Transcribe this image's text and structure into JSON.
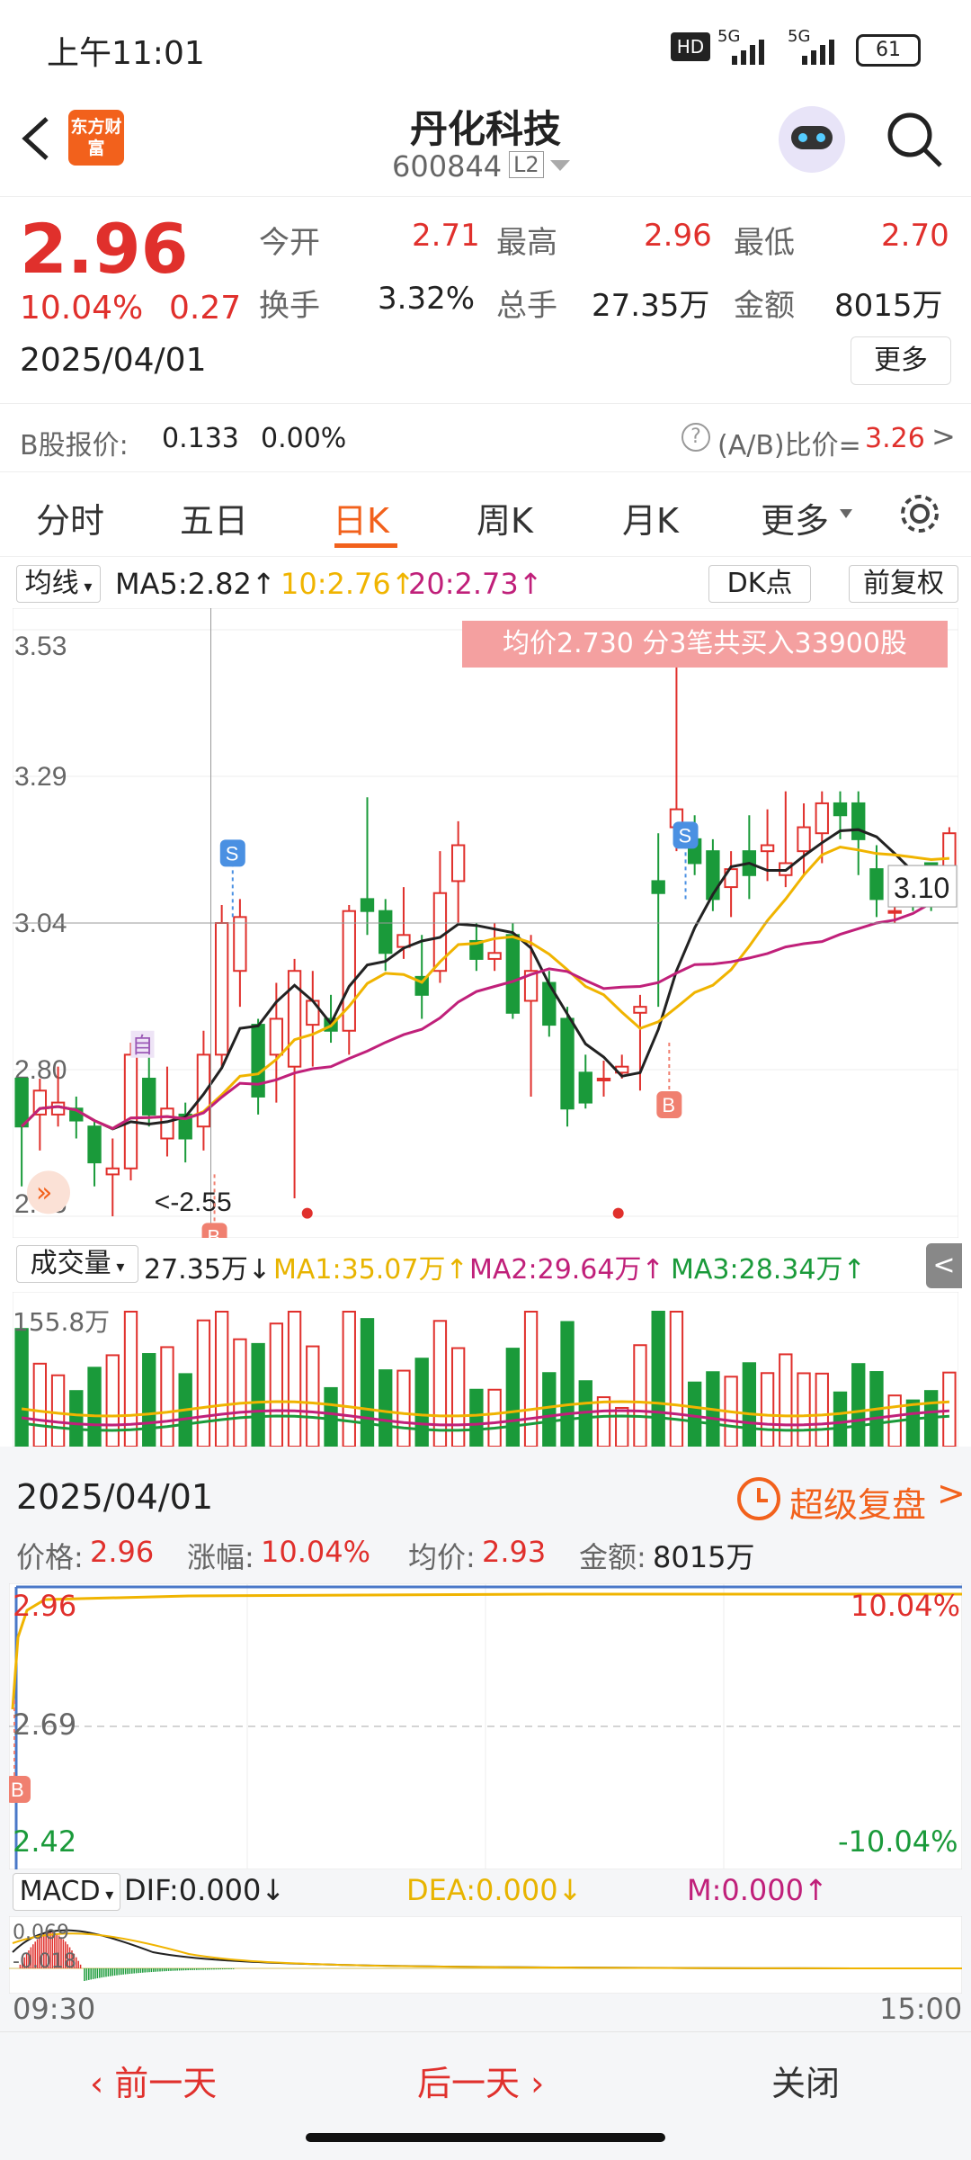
{
  "status": {
    "time": "上午11:01",
    "net1": "5G",
    "net2": "5G",
    "battery": "61"
  },
  "header": {
    "logo": "东方财富",
    "name": "丹化科技",
    "code": "600844",
    "level": "L2"
  },
  "quote": {
    "price": "2.96",
    "pct": "10.04%",
    "change": "0.27",
    "date": "2025/04/01",
    "open_label": "今开",
    "open": "2.71",
    "high_label": "最高",
    "high": "2.96",
    "low_label": "最低",
    "low": "2.70",
    "turnover_label": "换手",
    "turnover": "3.32%",
    "vol_label": "总手",
    "vol": "27.35万",
    "amount_label": "金额",
    "amount": "8015万",
    "more": "更多",
    "bshare_label": "B股报价:",
    "bshare_price": "0.133",
    "bshare_pct": "0.00%",
    "ratio_label": "(A/B)比价=",
    "ratio": "3.26"
  },
  "tabs": [
    "分时",
    "五日",
    "日K",
    "周K",
    "月K",
    "更多"
  ],
  "ma": {
    "label": "均线",
    "ma5": "MA5:2.82↑",
    "ma10": "10:2.76↑",
    "ma20": "20:2.73↑",
    "dk": "DK点",
    "fq": "前复权"
  },
  "kchart": {
    "y_labels": [
      "3.53",
      "3.29",
      "3.04",
      "2.80",
      "2.55"
    ],
    "banner": "均价2.730  分3笔共买入33900股",
    "high_note": "3.53->",
    "low_note": "<-2.55",
    "last_tag": "3.10",
    "zi": "自"
  },
  "volume": {
    "label": "成交量",
    "val": "27.35万↓",
    "ma1": "MA1:35.07万↑",
    "ma2": "MA2:29.64万↑",
    "ma3": "MA3:28.34万↑",
    "max": "155.8万"
  },
  "panel": {
    "date": "2025/04/01",
    "replay": "超级复盘",
    "price_label": "价格:",
    "price": "2.96",
    "pct_label": "涨幅:",
    "pct": "10.04%",
    "avg_label": "均价:",
    "avg": "2.93",
    "amt_label": "金额:",
    "amt": "8015万",
    "y_top": "2.96",
    "y_mid": "2.69",
    "y_bot": "2.42",
    "pct_top": "10.04%",
    "pct_bot": "-10.04%",
    "macd_label": "MACD",
    "dif": "DIF:0.000↓",
    "dea": "DEA:0.000↓",
    "m": "M:0.000↑",
    "macd_top": "0.069",
    "macd_bot": "-0.018",
    "t_start": "09:30",
    "t_end": "15:00"
  },
  "nav": {
    "prev": "前一天",
    "next": "后一天",
    "close": "关闭"
  },
  "colors": {
    "up": "#e0302c",
    "down": "#1a9a3a",
    "ma5": "#222222",
    "ma10": "#f0b400",
    "ma20": "#c0207a",
    "accent": "#f2611c"
  },
  "chart_data": {
    "type": "candlestick",
    "ylim": [
      2.55,
      3.53
    ],
    "candles": [
      [
        2.78,
        2.7,
        2.78,
        2.6
      ],
      [
        2.72,
        2.76,
        2.78,
        2.66
      ],
      [
        2.72,
        2.74,
        2.8,
        2.7
      ],
      [
        2.73,
        2.71,
        2.75,
        2.68
      ],
      [
        2.7,
        2.64,
        2.71,
        2.6
      ],
      [
        2.62,
        2.63,
        2.68,
        2.55
      ],
      [
        2.63,
        2.82,
        2.84,
        2.61
      ],
      [
        2.78,
        2.72,
        2.84,
        2.7
      ],
      [
        2.68,
        2.73,
        2.8,
        2.65
      ],
      [
        2.72,
        2.68,
        2.74,
        2.64
      ],
      [
        2.7,
        2.82,
        2.86,
        2.66
      ],
      [
        2.82,
        3.04,
        3.07,
        2.8
      ],
      [
        2.96,
        3.05,
        3.08,
        2.9
      ],
      [
        2.87,
        2.75,
        2.88,
        2.72
      ],
      [
        2.82,
        2.88,
        2.94,
        2.74
      ],
      [
        2.8,
        2.96,
        2.98,
        2.58
      ],
      [
        2.87,
        2.91,
        2.96,
        2.8
      ],
      [
        2.88,
        2.86,
        2.92,
        2.84
      ],
      [
        2.86,
        3.06,
        3.07,
        2.82
      ],
      [
        3.08,
        3.06,
        3.25,
        3.02
      ],
      [
        3.06,
        2.99,
        3.08,
        2.96
      ],
      [
        3.0,
        3.02,
        3.1,
        2.98
      ],
      [
        2.95,
        2.92,
        3.02,
        2.88
      ],
      [
        2.96,
        3.09,
        3.16,
        2.94
      ],
      [
        3.11,
        3.17,
        3.21,
        3.04
      ],
      [
        3.01,
        2.98,
        3.04,
        2.96
      ],
      [
        2.98,
        2.99,
        3.04,
        2.96
      ],
      [
        3.02,
        2.89,
        3.04,
        2.88
      ],
      [
        2.91,
        2.96,
        3.02,
        2.75
      ],
      [
        2.94,
        2.87,
        2.96,
        2.85
      ],
      [
        2.88,
        2.73,
        2.9,
        2.7
      ],
      [
        2.79,
        2.74,
        2.82,
        2.73
      ],
      [
        2.78,
        2.78,
        2.81,
        2.75
      ],
      [
        2.79,
        2.8,
        2.82,
        2.78
      ],
      [
        2.89,
        2.9,
        2.92,
        2.76
      ],
      [
        3.11,
        3.09,
        3.19,
        2.9
      ],
      [
        3.2,
        3.23,
        3.53,
        3.16
      ],
      [
        3.18,
        3.14,
        3.22,
        3.12
      ],
      [
        3.16,
        3.08,
        3.18,
        3.06
      ],
      [
        3.1,
        3.13,
        3.16,
        3.05
      ],
      [
        3.16,
        3.12,
        3.22,
        3.08
      ],
      [
        3.16,
        3.17,
        3.23,
        3.11
      ],
      [
        3.12,
        3.14,
        3.26,
        3.1
      ],
      [
        3.16,
        3.2,
        3.24,
        3.12
      ],
      [
        3.19,
        3.24,
        3.26,
        3.14
      ],
      [
        3.24,
        3.22,
        3.26,
        3.18
      ],
      [
        3.24,
        3.18,
        3.26,
        3.12
      ],
      [
        3.13,
        3.08,
        3.17,
        3.05
      ],
      [
        3.06,
        3.06,
        3.11,
        3.04
      ],
      [
        3.1,
        3.09,
        3.12,
        3.06
      ],
      [
        3.14,
        3.08,
        3.14,
        3.06
      ],
      [
        3.1,
        3.19,
        3.2,
        3.08
      ]
    ]
  }
}
